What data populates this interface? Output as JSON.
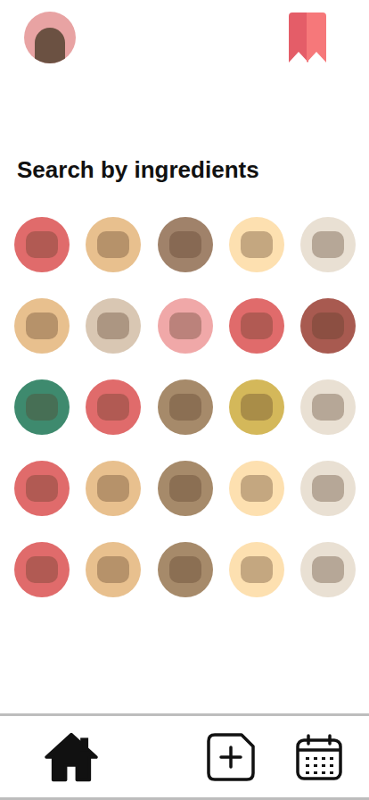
{
  "title": "Search by ingredients",
  "ingredients": [
    {
      "color": "#e06b6b"
    },
    {
      "color": "#e8c08e"
    },
    {
      "color": "#a0826a"
    },
    {
      "color": "#fde0b0"
    },
    {
      "color": "#e9e0d3"
    },
    {
      "color": "#e8c08e"
    },
    {
      "color": "#d9c7b3"
    },
    {
      "color": "#f0a8a8"
    },
    {
      "color": "#e06b6b"
    },
    {
      "color": "#a85a50"
    },
    {
      "color": "#3e8a6e"
    },
    {
      "color": "#e06b6b"
    },
    {
      "color": "#a68a6a"
    },
    {
      "color": "#d4b85a"
    },
    {
      "color": "#e9e0d3"
    },
    {
      "color": "#e06b6b"
    },
    {
      "color": "#e8c08e"
    },
    {
      "color": "#a68a6a"
    },
    {
      "color": "#fde0b0"
    },
    {
      "color": "#e9e0d3"
    },
    {
      "color": "#e06b6b"
    },
    {
      "color": "#e8c08e"
    },
    {
      "color": "#a68a6a"
    },
    {
      "color": "#fde0b0"
    },
    {
      "color": "#e9e0d3"
    }
  ],
  "nav": [
    {
      "kind": "home",
      "selected": true
    },
    {
      "kind": "add",
      "selected": false
    },
    {
      "kind": "calendar",
      "selected": false
    }
  ]
}
